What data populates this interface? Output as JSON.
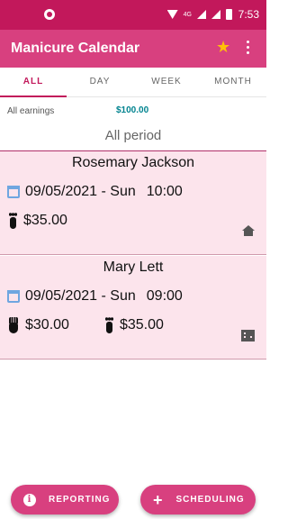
{
  "status_bar": {
    "time": "7:53",
    "network": "4G"
  },
  "app_bar": {
    "title": "Manicure Calendar",
    "favorite_icon": "star-icon",
    "menu_icon": "more-vert-icon"
  },
  "tabs": [
    {
      "label": "ALL",
      "active": true
    },
    {
      "label": "DAY",
      "active": false
    },
    {
      "label": "WEEK",
      "active": false
    },
    {
      "label": "MONTH",
      "active": false
    }
  ],
  "summary": {
    "earnings_label": "All earnings",
    "earnings_value": "$100.00",
    "period": "All period"
  },
  "appointments": [
    {
      "name": "Rosemary Jackson",
      "date": "09/05/2021 - Sun",
      "time": "10:00",
      "services": [
        {
          "icon": "foot-icon",
          "price": "$35.00"
        }
      ],
      "location_icon": "home-icon"
    },
    {
      "name": "Mary Lett",
      "date": "09/05/2021 - Sun",
      "time": "09:00",
      "services": [
        {
          "icon": "hand-icon",
          "price": "$30.00"
        },
        {
          "icon": "foot-icon",
          "price": "$35.00"
        }
      ],
      "location_icon": "building-icon"
    }
  ],
  "buttons": {
    "reporting": "REPORTING",
    "scheduling": "SCHEDULING"
  },
  "colors": {
    "primary": "#d8407f",
    "primary_dark": "#c2185b",
    "card_bg": "#fce4ec",
    "earnings": "#00838f",
    "star": "#ffc107"
  }
}
